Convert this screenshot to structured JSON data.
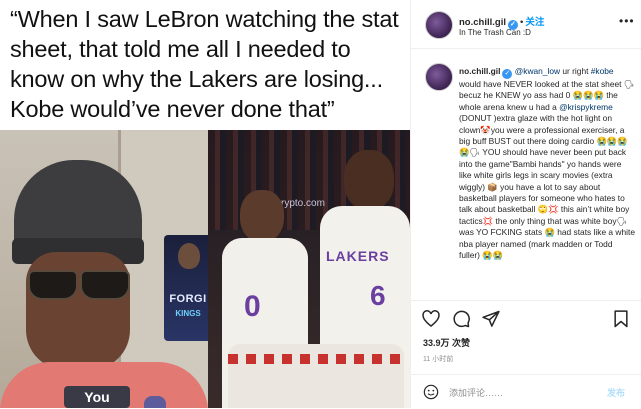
{
  "image": {
    "caption": "“When I saw LeBron watching the stat sheet, that told me all I needed to know on why the Lakers are losing... Kobe would’ve never done that”",
    "gaming_brand": "FORGI",
    "gaming_brand_sub": "KINGS",
    "camera_tag": "You",
    "jersey_team": "LAKERS",
    "jersey_num_left": "0",
    "jersey_num_right": "6",
    "arena_banner": "crypto.com"
  },
  "header": {
    "username": "no.chill.gil",
    "verified": "✓",
    "separator": "•",
    "follow_label": "关注",
    "subtitle": "In The Trash Can :D",
    "more": "•••"
  },
  "comment": {
    "username": "no.chill.gil",
    "mention": "@kwan_low",
    "text_a": " ur right ",
    "hashtag": "#kobe",
    "text_b": " would have NEVER looked at the stat sheet 🗣 becuz he KNEW yo ass had 0 😭😭😭 the whole arena knew u had a ",
    "mention2": "@krispykreme",
    "text_c": " (DONUT )extra glaze with the hot light on clown🤡you were a professional exerciser, a big buff BUST out there doing cardio 😭😭😭😭🗣 YOU should have never been put back into the game\"Bambi hands\" yo hands were like white girls legs in scary movies (extra wiggly) 📦 you have a lot to say about basketball players for someone who hates to talk about basketball 🙄💢 this ain’t white boy tactics💢 the only thing that was white boy🗣was YO FCKING stats 😭 had stats like a white nba player named (mark madden or Todd fuller) 😭😭"
  },
  "stats": {
    "likes": "33.9万 次赞",
    "time": "11 小时前"
  },
  "input": {
    "placeholder": "添加评论……",
    "post_label": "发布"
  },
  "colors": {
    "link": "#00376b",
    "follow": "#0095f6",
    "lakers_purple": "#6b3fa0"
  }
}
